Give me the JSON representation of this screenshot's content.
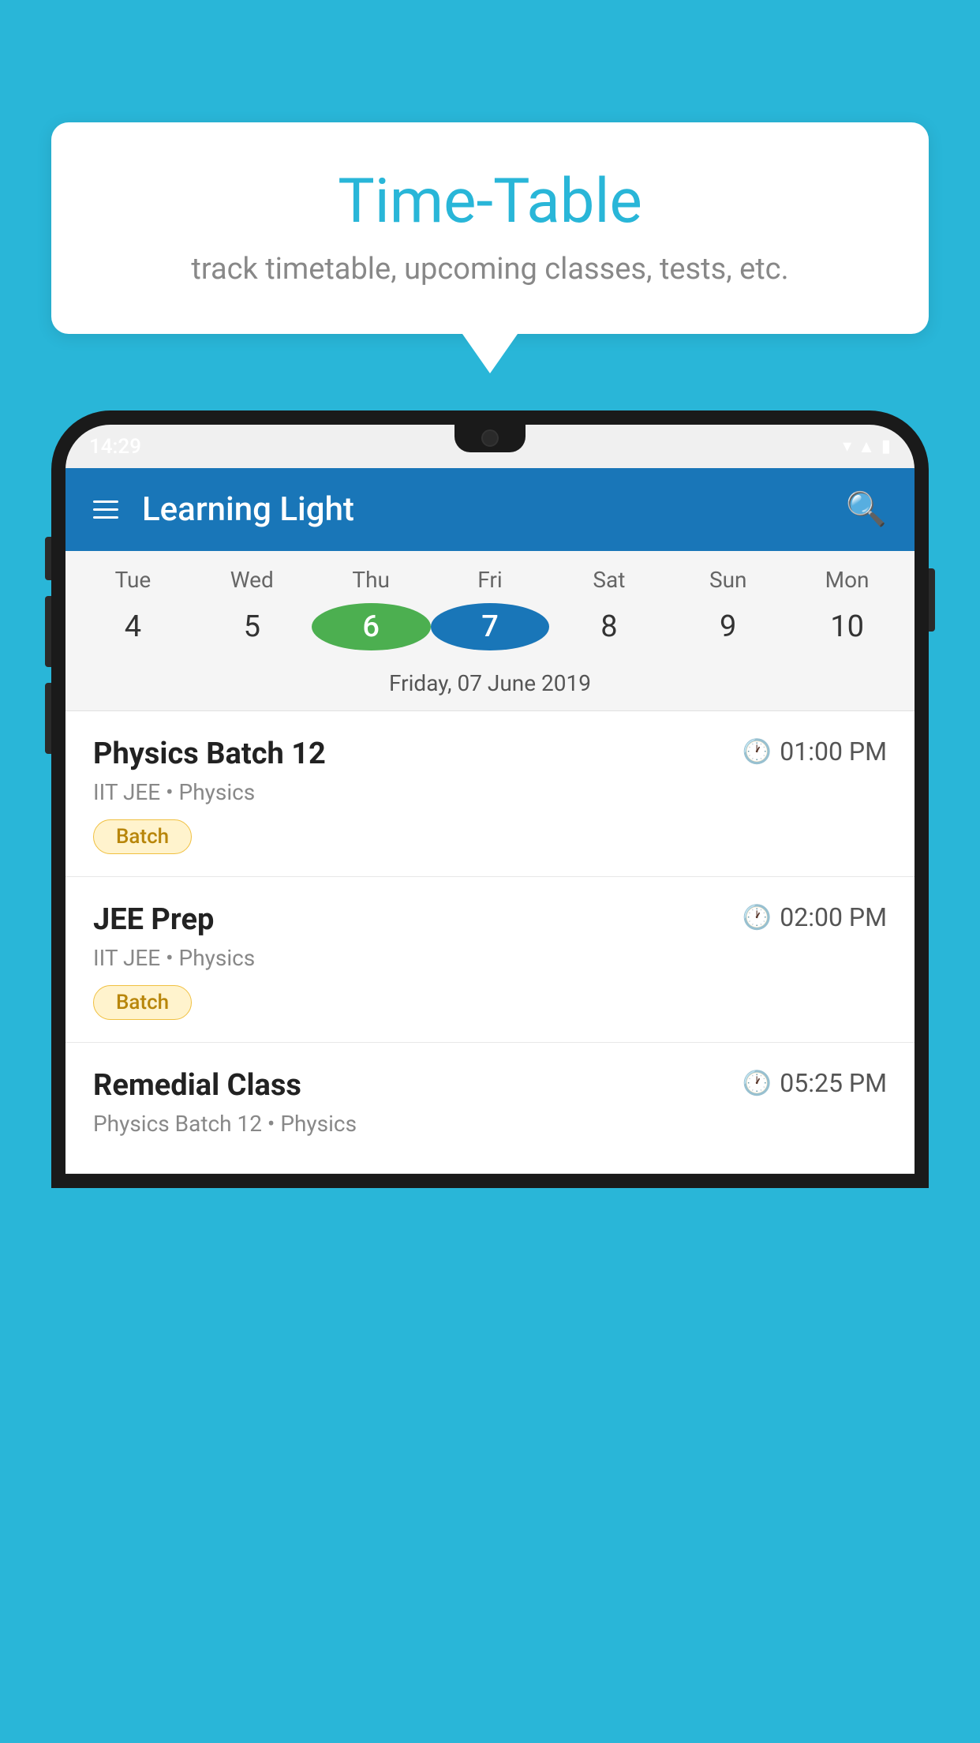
{
  "background_color": "#29B6D8",
  "speech_bubble": {
    "title": "Time-Table",
    "subtitle": "track timetable, upcoming classes, tests, etc."
  },
  "phone": {
    "status_bar": {
      "time": "14:29"
    },
    "app_bar": {
      "title": "Learning Light",
      "menu_label": "Menu",
      "search_label": "Search"
    },
    "calendar": {
      "days": [
        {
          "label": "Tue",
          "number": "4"
        },
        {
          "label": "Wed",
          "number": "5"
        },
        {
          "label": "Thu",
          "number": "6",
          "state": "today"
        },
        {
          "label": "Fri",
          "number": "7",
          "state": "selected"
        },
        {
          "label": "Sat",
          "number": "8"
        },
        {
          "label": "Sun",
          "number": "9"
        },
        {
          "label": "Mon",
          "number": "10"
        }
      ],
      "selected_date": "Friday, 07 June 2019"
    },
    "schedule": [
      {
        "name": "Physics Batch 12",
        "time": "01:00 PM",
        "subtitle": "IIT JEE • Physics",
        "badge": "Batch"
      },
      {
        "name": "JEE Prep",
        "time": "02:00 PM",
        "subtitle": "IIT JEE • Physics",
        "badge": "Batch"
      },
      {
        "name": "Remedial Class",
        "time": "05:25 PM",
        "subtitle": "Physics Batch 12 • Physics",
        "badge": null
      }
    ]
  }
}
